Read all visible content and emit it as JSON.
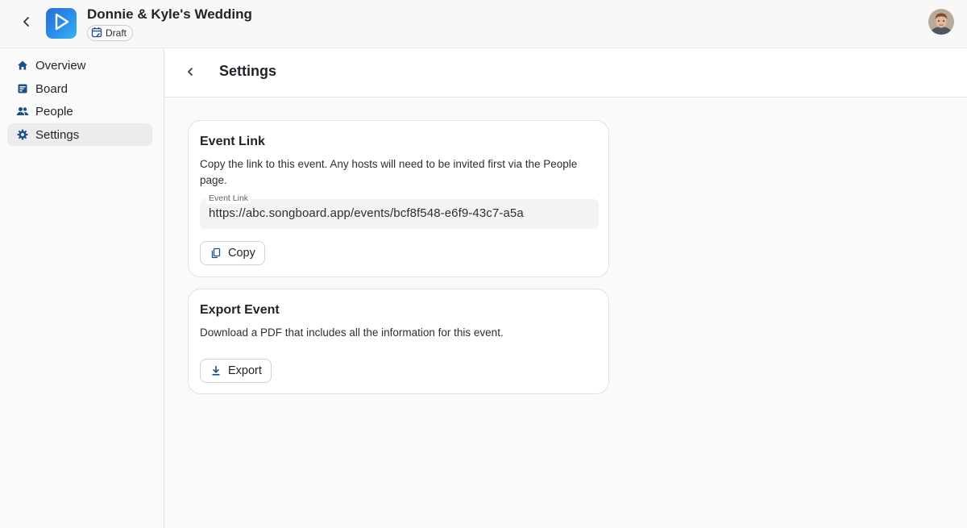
{
  "header": {
    "event_title": "Donnie & Kyle's Wedding",
    "status": "Draft",
    "icons": {
      "back": "chevron-left-icon",
      "logo": "play-logo",
      "status": "calendar-edit-icon",
      "avatar": "user-avatar"
    }
  },
  "sidebar": {
    "items": [
      {
        "label": "Overview",
        "icon": "home-icon",
        "active": false
      },
      {
        "label": "Board",
        "icon": "board-icon",
        "active": false
      },
      {
        "label": "People",
        "icon": "people-icon",
        "active": false
      },
      {
        "label": "Settings",
        "icon": "gear-icon",
        "active": true
      }
    ]
  },
  "page": {
    "title": "Settings"
  },
  "event_link_card": {
    "title": "Event Link",
    "description": "Copy the link to this event. Any hosts will need to be invited first via the People page.",
    "field_label": "Event Link",
    "field_value": "https://abc.songboard.app/events/bcf8f548-e6f9-43c7-a5a",
    "copy_label": "Copy"
  },
  "export_card": {
    "title": "Export Event",
    "description": "Download a PDF that includes all the information for this event.",
    "export_label": "Export"
  },
  "colors": {
    "accent": "#1f4f8a",
    "logo_gradient_start": "#2c6bd6",
    "logo_gradient_end": "#36b3f0",
    "active_nav_bg": "#ececec"
  }
}
